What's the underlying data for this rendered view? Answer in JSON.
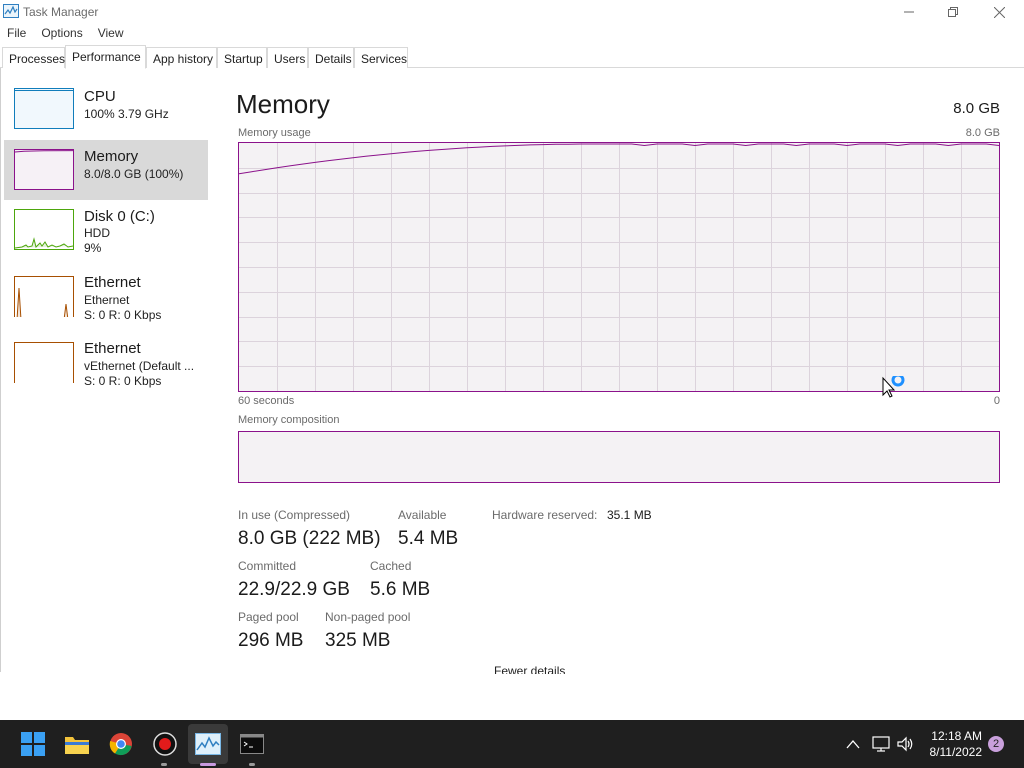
{
  "window": {
    "title": "Task Manager"
  },
  "menu": [
    "File",
    "Options",
    "View"
  ],
  "tabs": [
    "Processes",
    "Performance",
    "App history",
    "Startup",
    "Users",
    "Details",
    "Services"
  ],
  "active_tab": "Performance",
  "sidebar": {
    "items": [
      {
        "title": "CPU",
        "sub1": "100%  3.79 GHz",
        "sub2": ""
      },
      {
        "title": "Memory",
        "sub1": "8.0/8.0 GB (100%)",
        "sub2": ""
      },
      {
        "title": "Disk 0 (C:)",
        "sub1": "HDD",
        "sub2": "9%"
      },
      {
        "title": "Ethernet",
        "sub1": "Ethernet",
        "sub2": "S: 0  R: 0 Kbps"
      },
      {
        "title": "Ethernet",
        "sub1": "vEthernet (Default ...",
        "sub2": "S: 0  R: 0 Kbps"
      }
    ]
  },
  "main": {
    "title": "Memory",
    "total": "8.0 GB",
    "usage_label": "Memory usage",
    "usage_max": "8.0 GB",
    "time_label": "60 seconds",
    "time_end": "0",
    "composition_label": "Memory composition",
    "usage_percent": 100
  },
  "stats": {
    "in_use_label": "In use (Compressed)",
    "in_use_value": "8.0 GB (222 MB)",
    "available_label": "Available",
    "available_value": "5.4 MB",
    "hw_reserved_label": "Hardware reserved:",
    "hw_reserved_value": "35.1 MB",
    "committed_label": "Committed",
    "committed_value": "22.9/22.9 GB",
    "cached_label": "Cached",
    "cached_value": "5.6 MB",
    "paged_label": "Paged pool",
    "paged_value": "296 MB",
    "nonpaged_label": "Non-paged pool",
    "nonpaged_value": "325 MB"
  },
  "footer": {
    "fewer_details": "Fewer details"
  },
  "taskbar": {
    "apps": [
      "windows-start",
      "file-explorer",
      "chrome",
      "recorder",
      "task-manager",
      "terminal"
    ],
    "clock_time": "12:18 AM",
    "clock_date": "8/11/2022",
    "notification_count": "2"
  },
  "colors": {
    "memory_accent": "#8b128b",
    "cpu_accent": "#117dbb",
    "disk_accent": "#4da60c",
    "ethernet_accent": "#a74f01",
    "taskbar_bg": "#1f1f1f"
  }
}
